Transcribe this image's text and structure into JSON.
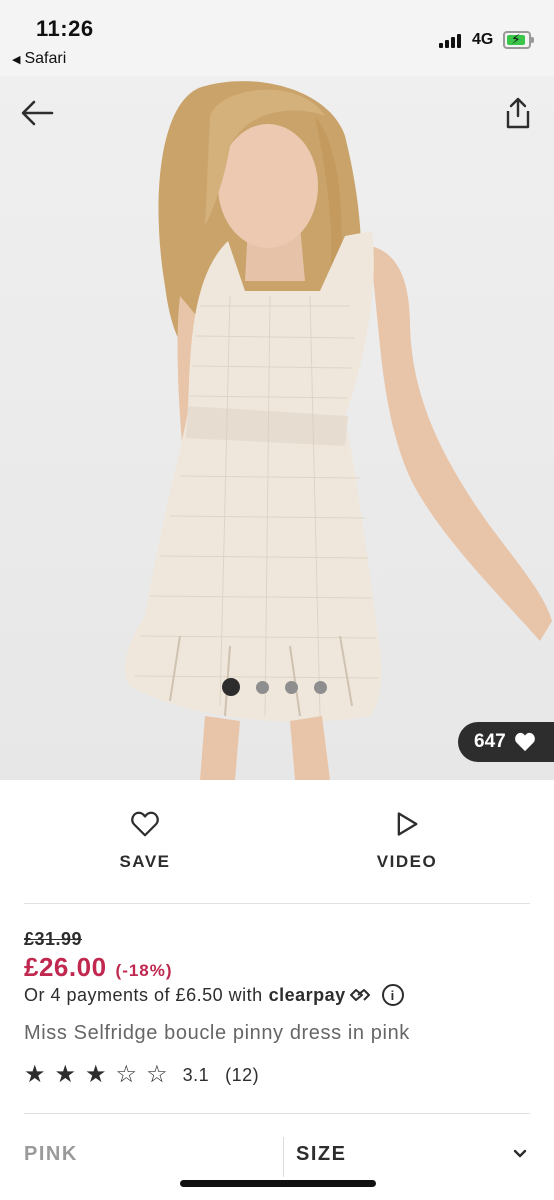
{
  "status_bar": {
    "time": "11:26",
    "back_app": "Safari",
    "network": "4G"
  },
  "gallery": {
    "likes": "647",
    "image_count": 4,
    "active_index": 0
  },
  "actions": {
    "save_label": "SAVE",
    "video_label": "VIDEO"
  },
  "product": {
    "old_price": "£31.99",
    "price": "£26.00",
    "discount": "(-18%)",
    "installments_text": "Or 4 payments of £6.50 with",
    "installments_provider": "clearpay",
    "title": "Miss Selfridge boucle pinny dress in pink",
    "rating_value": "3.1",
    "rating_count": "(12)",
    "stars_filled": 3,
    "stars_total": 5
  },
  "selectors": {
    "colour": "PINK",
    "size_label": "SIZE"
  },
  "colors": {
    "price_red": "#c0284f",
    "text_dark": "#2d2d2d",
    "text_muted": "#666666"
  }
}
